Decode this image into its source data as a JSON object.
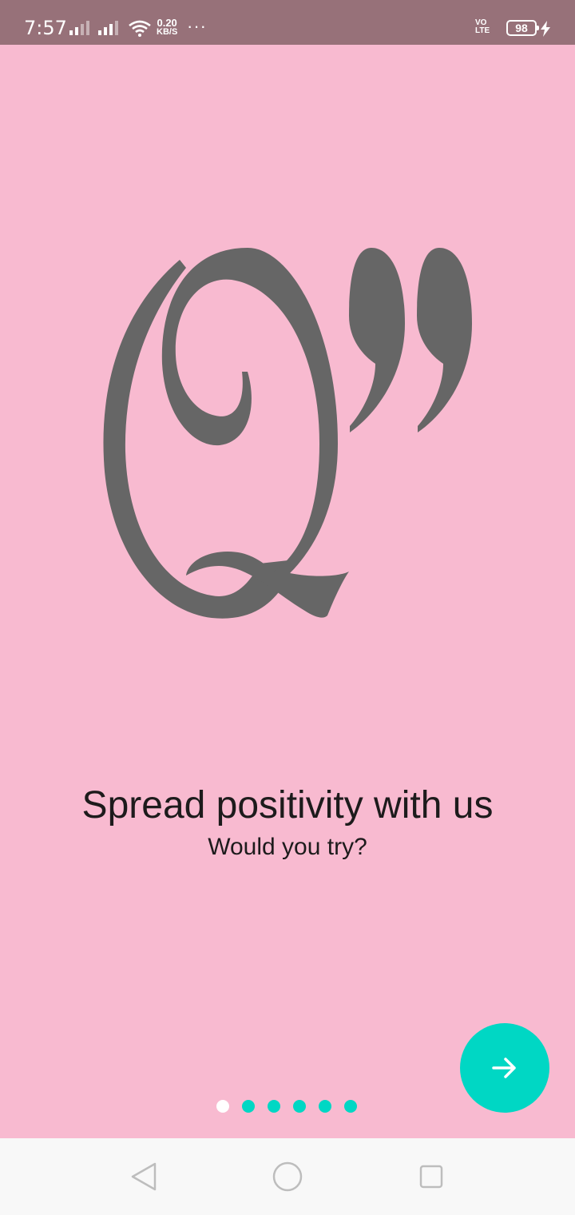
{
  "status_bar": {
    "time": "7:57",
    "net_speed_value": "0.20",
    "net_speed_unit": "KB/S",
    "more": "···",
    "volte_top": "VO",
    "volte_bottom": "LTE",
    "battery": "98",
    "icons": [
      "signal-icon",
      "signal-icon",
      "wifi-icon",
      "volte-icon",
      "battery-icon",
      "charging-icon"
    ]
  },
  "onboarding": {
    "logo_icon": "quote-q-logo-icon",
    "title": "Spread positivity with us",
    "subtitle": "Would you try?",
    "next_icon": "arrow-right-icon",
    "page_count": 6,
    "current_page": 1
  },
  "nav_bar": {
    "icons": [
      "back-icon",
      "home-icon",
      "recents-icon"
    ]
  },
  "colors": {
    "background": "#f8bad0",
    "status_bar": "#977179",
    "accent": "#00d7c4",
    "logo": "#666666",
    "text": "#1d1b1c",
    "nav_bar": "#f8f8f8"
  }
}
